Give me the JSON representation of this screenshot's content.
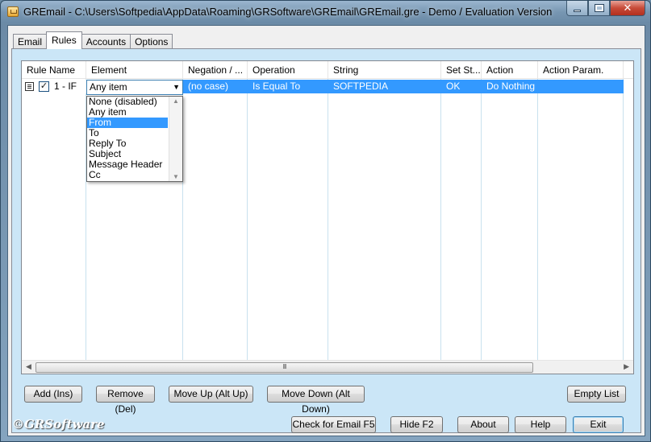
{
  "window": {
    "title": "GREmail - C:\\Users\\Softpedia\\AppData\\Roaming\\GRSoftware\\GREmail\\GREmail.gre - Demo / Evaluation Version"
  },
  "tabs": [
    "Email",
    "Rules",
    "Accounts",
    "Options"
  ],
  "active_tab": "Rules",
  "grid": {
    "columns": [
      "Rule Name",
      "Element",
      "Negation / ...",
      "Operation",
      "String",
      "Set St...",
      "Action",
      "Action Param."
    ],
    "rows": [
      {
        "checked": true,
        "rule_name": "1 - IF",
        "element": "Any item",
        "negation": "(no case)",
        "operation": "Is Equal To",
        "string": "SOFTPEDIA",
        "set_status": "OK",
        "action": "Do Nothing",
        "action_param": ""
      }
    ]
  },
  "element_dropdown": {
    "selected": "From",
    "options": [
      "None (disabled)",
      "Any item",
      "From",
      "To",
      "Reply To",
      "Subject",
      "Message Header",
      "Cc"
    ]
  },
  "rule_buttons": {
    "add": "Add (Ins)",
    "remove": "Remove (Del)",
    "move_up": "Move Up (Alt Up)",
    "move_down": "Move Down (Alt Down)",
    "empty": "Empty List"
  },
  "footer": {
    "logo": "©GRSoftware",
    "check_email": "Check for Email F5",
    "hide": "Hide F2",
    "about": "About",
    "help": "Help",
    "exit": "Exit"
  },
  "scrollbar_thumb": "III"
}
